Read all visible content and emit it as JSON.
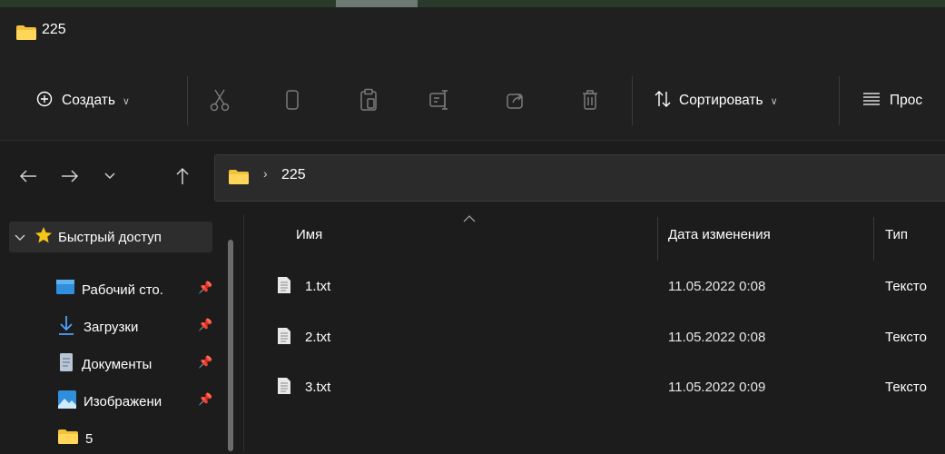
{
  "window": {
    "title": "225"
  },
  "toolbar": {
    "new_label": "Создать",
    "sort_label": "Сортировать",
    "view_label": "Прос",
    "icons": [
      "cut-icon",
      "copy-icon",
      "paste-icon",
      "rename-icon",
      "share-icon",
      "delete-icon"
    ]
  },
  "address": {
    "crumbs": [
      "225"
    ]
  },
  "sidebar": {
    "items": [
      {
        "label": "Быстрый доступ",
        "icon": "star-icon",
        "pinned": false
      },
      {
        "label": "Рабочий сто.",
        "icon": "desktop-icon",
        "pinned": true
      },
      {
        "label": "Загрузки",
        "icon": "download-icon",
        "pinned": true
      },
      {
        "label": "Документы",
        "icon": "document-icon",
        "pinned": true
      },
      {
        "label": "Изображени",
        "icon": "pictures-icon",
        "pinned": true
      },
      {
        "label": "5",
        "icon": "folder-icon",
        "pinned": false
      }
    ]
  },
  "columns": {
    "name": "Имя",
    "date": "Дата изменения",
    "type": "Тип"
  },
  "files": [
    {
      "name": "1.txt",
      "date": "11.05.2022 0:08",
      "type": "Тексто"
    },
    {
      "name": "2.txt",
      "date": "11.05.2022 0:08",
      "type": "Тексто"
    },
    {
      "name": "3.txt",
      "date": "11.05.2022 0:09",
      "type": "Тексто"
    }
  ],
  "colors": {
    "background": "#1c1c1c",
    "toolbar": "#202020",
    "folder": "#f2c13a",
    "accent": "#4da3ff"
  }
}
